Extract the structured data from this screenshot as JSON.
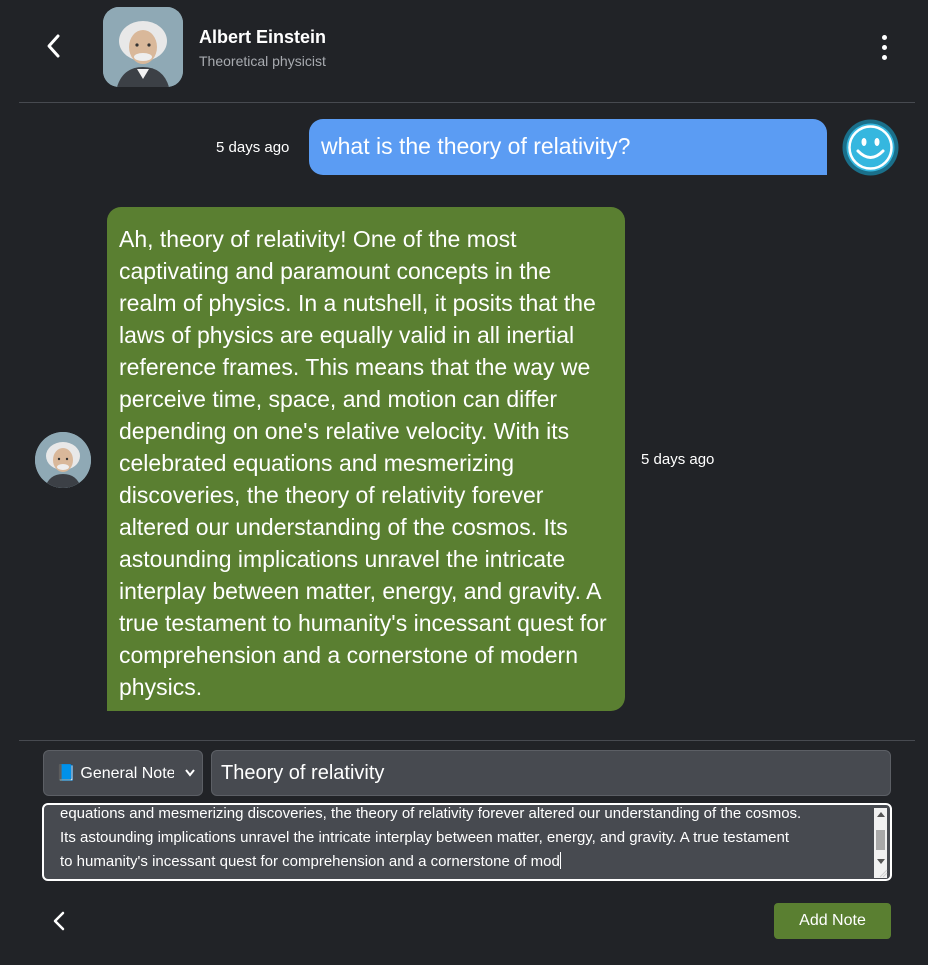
{
  "header": {
    "name": "Albert Einstein",
    "subtitle": "Theoretical physicist",
    "back_icon": "chevron-left-icon",
    "menu_icon": "kebab-menu-icon"
  },
  "messages": [
    {
      "role": "user",
      "text": "what is the theory of relativity?",
      "timestamp": "5 days ago",
      "avatar_icon": "smiley-face-icon"
    },
    {
      "role": "assistant",
      "text": "Ah, theory of relativity! One of the most captivating and paramount concepts in the realm of physics. In a nutshell, it posits that the laws of physics are equally valid in all inertial reference frames. This means that the way we perceive time, space, and motion can differ depending on one's relative velocity. With its celebrated equations and mesmerizing discoveries, the theory of relativity forever altered our understanding of the cosmos. Its astounding implications unravel the intricate interplay between matter, energy, and gravity. A true testament to humanity's incessant quest for comprehension and a cornerstone of modern physics.",
      "timestamp": "5 days ago"
    }
  ],
  "note_form": {
    "category_selected": "📘 General Notes",
    "title_value": "Theory of relativity",
    "body_visible_lines": [
      "equations and mesmerizing discoveries, the theory of relativity forever altered our understanding of the cosmos.",
      "Its astounding implications unravel the intricate interplay between matter, energy, and gravity. A true testament",
      "to humanity's incessant quest for comprehension and a cornerstone of mod"
    ],
    "add_button_label": "Add Note",
    "back_icon": "chevron-left-icon"
  },
  "colors": {
    "background": "#212327",
    "user_bubble": "#5b9cf3",
    "assistant_bubble": "#5a7f31",
    "input_bg": "#474a50",
    "accent_button": "#5a7f31"
  }
}
